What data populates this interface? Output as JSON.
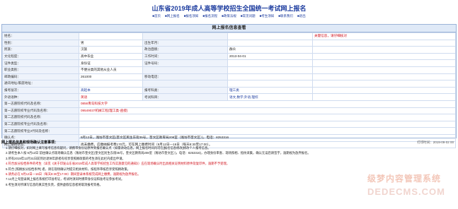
{
  "header": {
    "title": "山东省2019年成人高等学校招生全国统一考试网上报名",
    "nav": [
      "■首页",
      "■网上报名",
      "■报名须知",
      "■报名流程",
      "■政策法规",
      "■常见问题",
      "■考生须知",
      "■联系我们",
      "■退出"
    ]
  },
  "panel": {
    "title": "网上报名信息查看",
    "rows": [
      {
        "l1": "姓名：",
        "v1": "",
        "l2": "",
        "v2": "",
        "l3": "",
        "v3": "",
        "extra": "关键信息，请仔细核对"
      },
      {
        "l1": "性别：",
        "v1": "男",
        "l2": "出生年月：",
        "v2": "",
        "l3": "",
        "v3": ""
      },
      {
        "l1": "民族：",
        "v1": "汉族",
        "l2": "政治面貌：",
        "v2": "群众",
        "l3": "",
        "v3": ""
      },
      {
        "l1": "文化程度：",
        "v1": "高中毕业",
        "l2": "工作时间：",
        "v2": "2013-04-01",
        "l3": "",
        "v3": ""
      },
      {
        "l1": "证件类型：",
        "v1": "身份证",
        "l2": "证件号码：",
        "v2": "",
        "l3": "",
        "v3": ""
      },
      {
        "l1": "职业类别：",
        "v1": "不便分类的其他从业人员",
        "l2": "",
        "v2": "",
        "l3": "",
        "v3": ""
      },
      {
        "l1": "邮政编码：",
        "v1": "261000",
        "l2": "移动电话：",
        "v2": "",
        "l3": "",
        "v3": ""
      },
      {
        "l1": "通讯地址/家庭地址：",
        "v1": "",
        "l2": "",
        "v2": "",
        "l3": "",
        "v3": ""
      },
      {
        "l1": "报考层次：",
        "v1": "高起本",
        "l2": "报考科类：",
        "v2": "理工类",
        "l3": "",
        "v3": ""
      },
      {
        "l1": "外语语种：",
        "v1": "英语",
        "l2": "考试科目：",
        "v2": "语文,数学,外语,理综",
        "l3": "",
        "v3": ""
      },
      {
        "l1": "第一志愿院校代码及名称：",
        "v1": "",
        "l2": "",
        "v2": "0856青岛科技大学",
        "l3": "",
        "v3": ""
      },
      {
        "l1": "第一志愿院校专业代码及名称：",
        "v1": "",
        "l2": "",
        "v2": "09549037机械工程(理工类-函授)",
        "l3": "",
        "v3": ""
      },
      {
        "l1": "第二志愿院校代码及名称：",
        "v1": "",
        "l2": "",
        "v2": "",
        "l3": "",
        "v3": ""
      },
      {
        "l1": "第二志愿院校专业代码及名称：",
        "v1": "",
        "l2": "",
        "v2": "",
        "l3": "",
        "v3": ""
      },
      {
        "l1": "第二志愿院校专业2代码及名称：",
        "v1": "",
        "l2": "",
        "v2": "",
        "l3": "",
        "v3": ""
      },
      {
        "l1": "确认点：",
        "v1": "",
        "l2": "",
        "v2": "9月12日，潍坊市奎文区(奎文区民生东街35号，奎文区教育局208室（潍坊市奎文区）)，电话：8253316",
        "l3": "",
        "v3": ""
      },
      {
        "l1": "网上缴费状态：",
        "v1": "",
        "l2": "",
        "v2": "尚未缴费，应缴纳报考费170元，可在网上缴费时间（9月12日—16日（每天8:30至17:00）。",
        "l3": "",
        "v3": ""
      }
    ]
  },
  "notice": {
    "title": "网上报名信息和现场确认注意事项：",
    "date": "打印时间：2019-09-02 00",
    "items": [
      "1.请仔细核对，如对网上填写报考信息有疑问，请携带身份证原件到报名确认点（如需改动信息，网上报名时间内可在[报名信息修改]修改个人报考信息。",
      "2.请考生本人按 9月12日 前往确认点现场确认信息（潍坊市奎文区(奎文区民生东街35号，奎文区教育局208室（潍坊市奎文区）)，电话：8253316)，办理身份审查、现场照相、指纹采集，确认无误后请签字，逾期视为放弃报名。",
      "3.所有2019年12月31日前到达退休年龄者有权享受照顾政策的考生须在此栏内提出申请。",
      "4.符合加分投档条件的考生（详见《关于印发山东省2019年成人高等学校招生工作实施意见的通知》）应在现场确认时出具相关证明材料原件及复印件，逾期不予受理。",
      "5.符合 [照顾加分投档条件] 者，请在现场确认时提交相关材料，按程序审核后享受照顾政策。",
      "6.请务必在 9月12日—16日（每天8:30至17:00）期间登录本系统完成网上缴费，逾期视为放弃报名。",
      "7.12月上旬登录网上报名系统打印准考证，考试时须同时携带身份证和准考证参加考试。",
      "8.考生须对所填写信息的真实性负责，提供虚假信息者将取消报考资格。"
    ]
  },
  "watermark": {
    "line1": "级梦内容管理系统",
    "line2": "DEDECMS.COM"
  },
  "colors": {
    "title": "#1a3a9e",
    "emphasis": "#d0101a",
    "label_bg": "#eef3fb",
    "border": "#9bb3d8"
  }
}
